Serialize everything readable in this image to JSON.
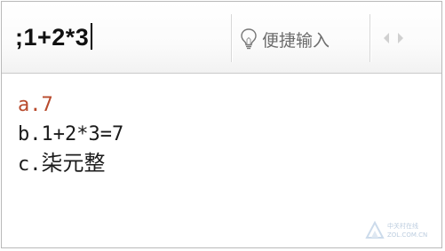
{
  "input_bar": {
    "composition_text": ";1+2*3",
    "quick_input_label": "便捷输入",
    "quick_input_icon": "lightbulb-icon",
    "prev_page_icon": "triangle-left-icon",
    "next_page_icon": "triangle-right-icon"
  },
  "candidates": [
    {
      "key": "a.",
      "text": "7",
      "selected": true
    },
    {
      "key": "b.",
      "text": "1+2*3=7",
      "selected": false
    },
    {
      "key": "c.",
      "text": "柒元整",
      "selected": false
    }
  ],
  "watermark": {
    "line1": "中关村在线",
    "line2": "ZOL.COM.CN"
  },
  "colors": {
    "selected_candidate": "#b84a2c",
    "candidate_text": "#1b1b1b",
    "label_gray": "#6c6c6c",
    "border": "#b9b9b9"
  }
}
